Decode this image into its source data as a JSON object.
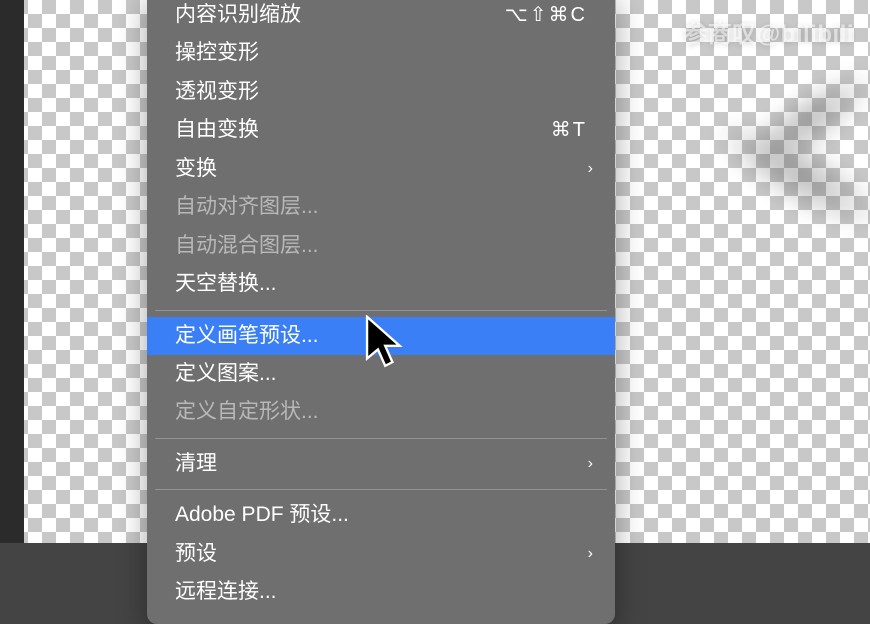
{
  "watermark": "参商叹@bilibili",
  "menu": {
    "items": [
      {
        "label": "内容识别缩放",
        "shortcut": "⌥⇧⌘C",
        "enabled": true
      },
      {
        "label": "操控变形",
        "enabled": true
      },
      {
        "label": "透视变形",
        "enabled": true
      },
      {
        "label": "自由变换",
        "shortcut": "⌘T",
        "enabled": true
      },
      {
        "label": "变换",
        "submenu": true,
        "enabled": true
      },
      {
        "label": "自动对齐图层...",
        "enabled": false
      },
      {
        "label": "自动混合图层...",
        "enabled": false
      },
      {
        "label": "天空替换...",
        "enabled": true
      },
      {
        "separator": true
      },
      {
        "label": "定义画笔预设...",
        "enabled": true,
        "highlight": true
      },
      {
        "label": "定义图案...",
        "enabled": true
      },
      {
        "label": "定义自定形状...",
        "enabled": false
      },
      {
        "separator": true
      },
      {
        "label": "清理",
        "submenu": true,
        "enabled": true
      },
      {
        "separator": true
      },
      {
        "label": "Adobe PDF 预设...",
        "enabled": true
      },
      {
        "label": "预设",
        "submenu": true,
        "enabled": true
      },
      {
        "label": "远程连接...",
        "enabled": true
      }
    ]
  }
}
